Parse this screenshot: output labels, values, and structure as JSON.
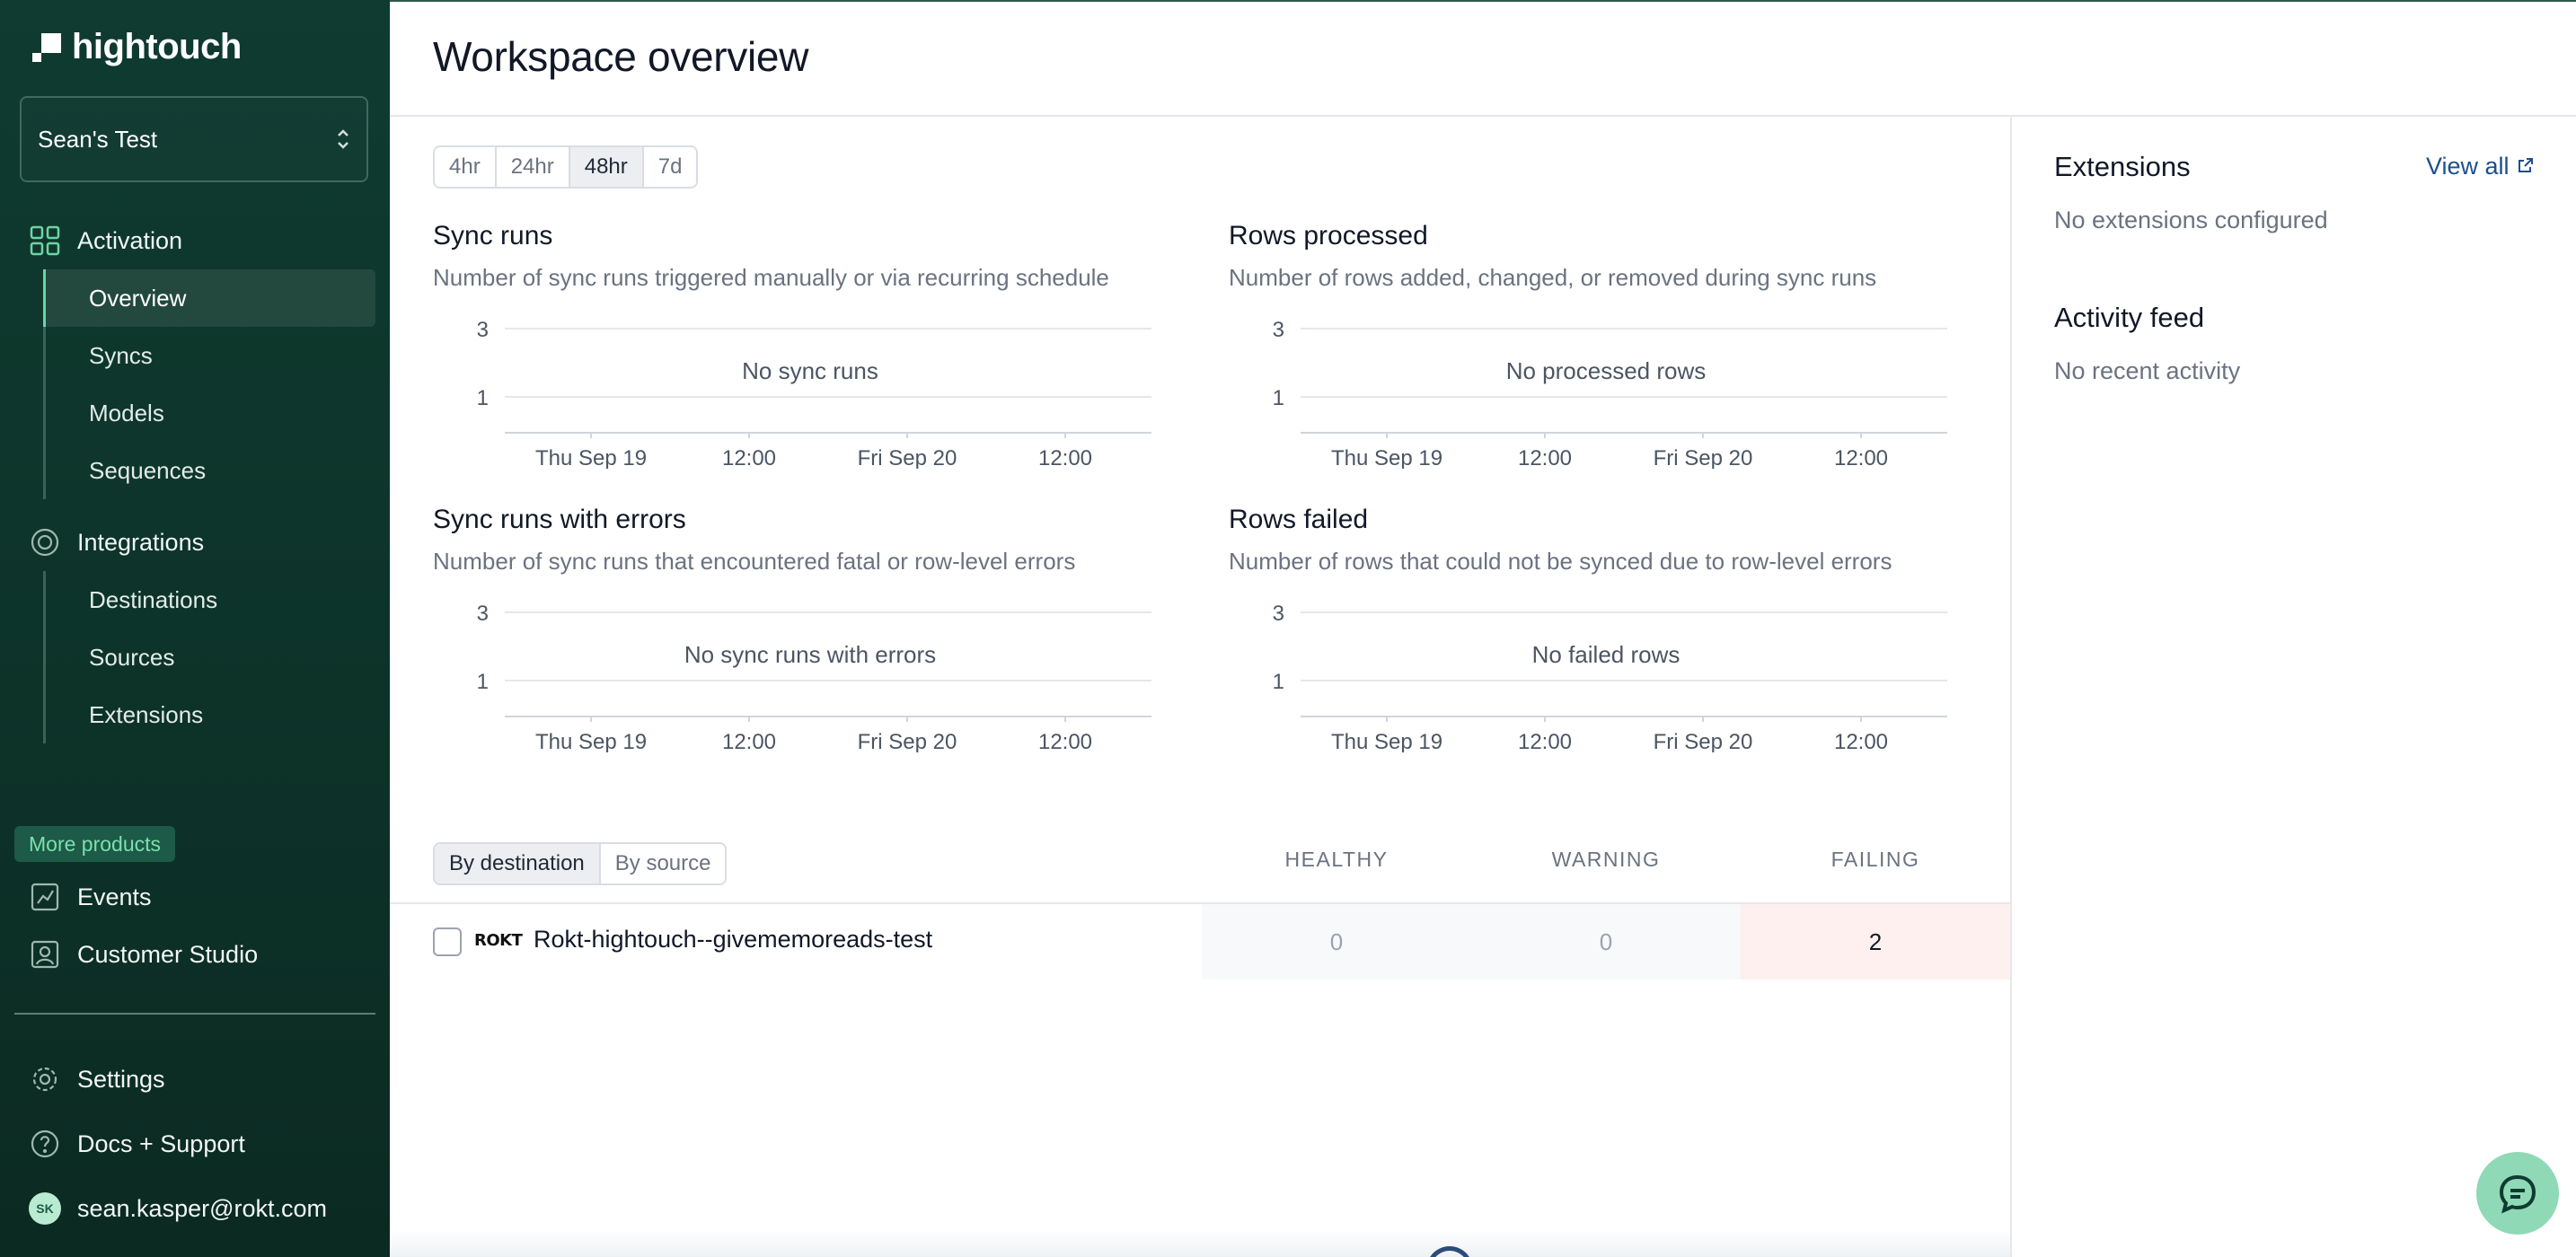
{
  "app": {
    "brand": "hightouch",
    "workspace": "Sean's Test"
  },
  "sidebar": {
    "activation": {
      "label": "Activation",
      "items": [
        {
          "label": "Overview",
          "active": true
        },
        {
          "label": "Syncs"
        },
        {
          "label": "Models"
        },
        {
          "label": "Sequences"
        }
      ]
    },
    "integrations": {
      "label": "Integrations",
      "items": [
        {
          "label": "Destinations"
        },
        {
          "label": "Sources"
        },
        {
          "label": "Extensions"
        }
      ]
    },
    "more_products_label": "More products",
    "products": [
      {
        "label": "Events",
        "icon": "events-icon"
      },
      {
        "label": "Customer Studio",
        "icon": "customer-studio-icon"
      }
    ],
    "footer": {
      "settings": "Settings",
      "docs": "Docs + Support",
      "user_email": "sean.kasper@rokt.com",
      "user_initials": "SK"
    }
  },
  "main": {
    "title": "Workspace overview",
    "time_ranges": [
      "4hr",
      "24hr",
      "48hr",
      "7d"
    ],
    "selected_range": "48hr"
  },
  "charts": [
    {
      "title": "Sync runs",
      "subtitle": "Number of sync runs triggered manually or via recurring schedule",
      "empty": "No sync runs"
    },
    {
      "title": "Rows processed",
      "subtitle": "Number of rows added, changed, or removed during sync runs",
      "empty": "No processed rows"
    },
    {
      "title": "Sync runs with errors",
      "subtitle": "Number of sync runs that encountered fatal or row-level errors",
      "empty": "No sync runs with errors"
    },
    {
      "title": "Rows failed",
      "subtitle": "Number of rows that could not be synced due to row-level errors",
      "empty": "No failed rows"
    }
  ],
  "chart_data": [
    {
      "type": "line",
      "title": "Sync runs",
      "y_ticks": [
        3,
        1
      ],
      "x_ticks": [
        "Thu Sep 19",
        "12:00",
        "Fri Sep 20",
        "12:00"
      ],
      "series": []
    },
    {
      "type": "line",
      "title": "Rows processed",
      "y_ticks": [
        3,
        1
      ],
      "x_ticks": [
        "Thu Sep 19",
        "12:00",
        "Fri Sep 20",
        "12:00"
      ],
      "series": []
    },
    {
      "type": "line",
      "title": "Sync runs with errors",
      "y_ticks": [
        3,
        1
      ],
      "x_ticks": [
        "Thu Sep 19",
        "12:00",
        "Fri Sep 20",
        "12:00"
      ],
      "series": []
    },
    {
      "type": "line",
      "title": "Rows failed",
      "y_ticks": [
        3,
        1
      ],
      "x_ticks": [
        "Thu Sep 19",
        "12:00",
        "Fri Sep 20",
        "12:00"
      ],
      "series": []
    }
  ],
  "health": {
    "tabs": [
      "By destination",
      "By source"
    ],
    "selected_tab": "By destination",
    "columns": [
      "HEALTHY",
      "WARNING",
      "FAILING"
    ],
    "rows": [
      {
        "logo_text": "ROKT",
        "name": "Rokt-hightouch--givememoreads-test",
        "healthy": "0",
        "warning": "0",
        "failing": "2"
      }
    ]
  },
  "right_panel": {
    "extensions_title": "Extensions",
    "view_all": "View all",
    "extensions_empty": "No extensions configured",
    "activity_title": "Activity feed",
    "activity_empty": "No recent activity"
  },
  "colors": {
    "sidebar_bg": "#0f3b30",
    "accent_green": "#6fd3a4",
    "failing_bg": "#fdf0ee",
    "link_blue": "#1d4f8f"
  }
}
